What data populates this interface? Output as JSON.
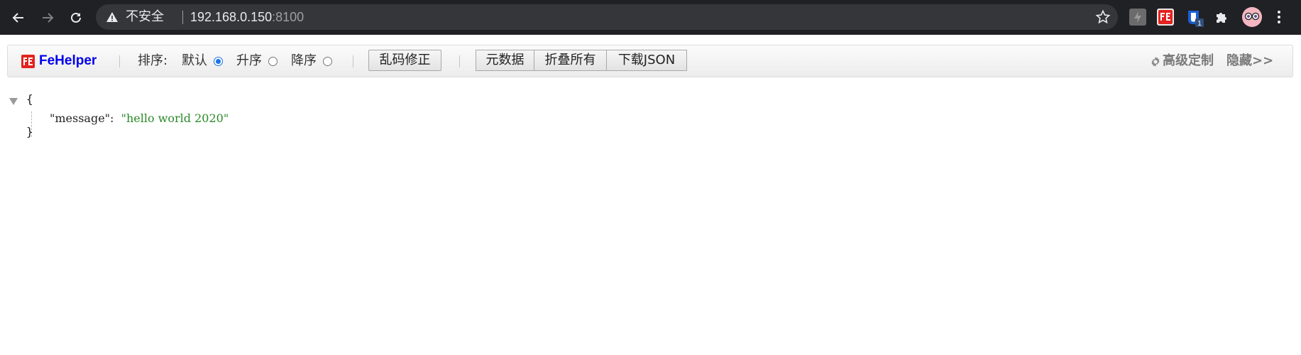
{
  "browser": {
    "security_label": "不安全",
    "url_host": "192.168.0.150",
    "url_port": ":8100",
    "extensions": [
      "lightning-extension-icon",
      "fehelper-extension-icon",
      "blue-extension-icon",
      "puzzle-icon"
    ],
    "extension_badge": "1"
  },
  "toolbar": {
    "brand": "FeHelper",
    "sort_label": "排序:",
    "sort_options": [
      {
        "label": "默认",
        "selected": true
      },
      {
        "label": "升序",
        "selected": false
      },
      {
        "label": "降序",
        "selected": false
      }
    ],
    "fix_encoding": "乱码修正",
    "metadata": "元数据",
    "collapse_all": "折叠所有",
    "download_json": "下载JSON",
    "advanced": "高级定制",
    "hide": "隐藏>>"
  },
  "json": {
    "open_brace": "{",
    "close_brace": "}",
    "key": "\"message\"",
    "colon": ":",
    "value": "\"hello world 2020\""
  },
  "colors": {
    "chrome_bg": "#202124",
    "brand_blue": "#0000ee",
    "string_green": "#2a8a2a",
    "radio_blue": "#1a73e8"
  }
}
